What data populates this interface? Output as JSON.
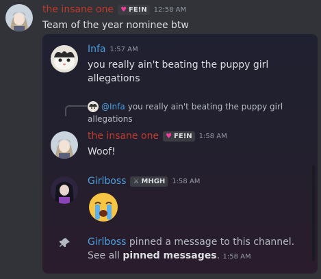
{
  "top_message": {
    "author": "the insane one",
    "tag": "FE!N",
    "timestamp": "12:58 AM",
    "content": "Team of the year nominee btw"
  },
  "embedded": {
    "messages": [
      {
        "author": "Infa",
        "timestamp": "1:57 AM",
        "line1": "you really ain't beating the puppy girl",
        "line2": "allegations"
      },
      {
        "author": "the insane one",
        "tag": "FE!N",
        "timestamp": "1:58 AM",
        "content": "Woof!",
        "reply": {
          "author": "@Infa",
          "text1": "you really ain't beating the puppy girl",
          "text2": "allegations"
        }
      },
      {
        "author": "Girlboss",
        "tag": "MHGH",
        "timestamp": "1:58 AM",
        "content": "😭"
      }
    ],
    "system": {
      "author": "Girlboss",
      "line1_rest": "pinned a message to this channel.",
      "line2_prefix": "See all",
      "link": "pinned messages",
      "line2_suffix": ".",
      "timestamp": "1:58 AM"
    }
  },
  "colors": {
    "background": "#313338",
    "red_name": "#c03a2b",
    "blue_name": "#4a9fe0",
    "tag_icon": "#f23f9c"
  },
  "icons": [
    "anime-avatar",
    "cat-avatar",
    "heart-skull-icon",
    "sword-icon",
    "pin-icon",
    "sobbing-emoji"
  ]
}
